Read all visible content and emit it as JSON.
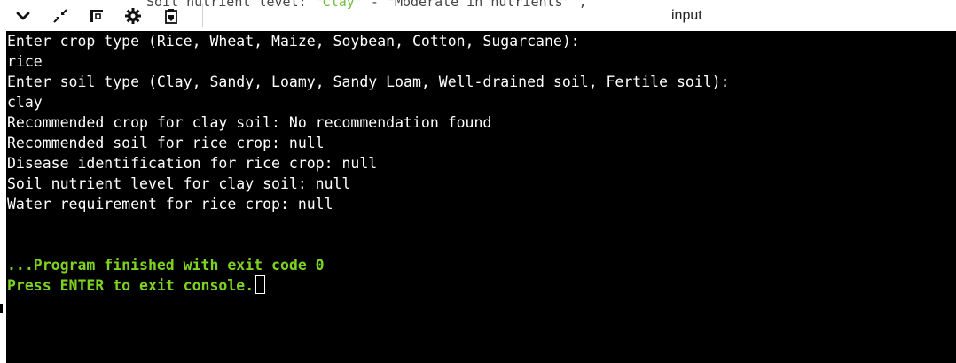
{
  "toolbar": {
    "title": "input",
    "background_code_prefix": "Soil nutrient level: ",
    "background_code_highlight": "\"Clay\"",
    "background_code_suffix": " - \"Moderate in nutrients\" ,",
    "buttons": [
      {
        "name": "expand-button",
        "icon": "chevron-down-icon"
      },
      {
        "name": "fullscreen-button",
        "icon": "compress-arrows-icon"
      },
      {
        "name": "layout-button",
        "icon": "layout-icon"
      },
      {
        "name": "settings-button",
        "icon": "gear-icon"
      },
      {
        "name": "copy-button",
        "icon": "clipboard-icon"
      }
    ]
  },
  "console": {
    "background": "#000000",
    "text_color": "#ffffff",
    "status_color": "#7ed321",
    "lines": [
      "Enter crop type (Rice, Wheat, Maize, Soybean, Cotton, Sugarcane):",
      "rice",
      "Enter soil type (Clay, Sandy, Loamy, Sandy Loam, Well-drained soil, Fertile soil):",
      "clay",
      "Recommended crop for clay soil: No recommendation found",
      "Recommended soil for rice crop: null",
      "Disease identification for rice crop: null",
      "Soil nutrient level for clay soil: null",
      "Water requirement for rice crop: null"
    ],
    "exit_message": "...Program finished with exit code 0",
    "prompt": "Press ENTER to exit console."
  }
}
